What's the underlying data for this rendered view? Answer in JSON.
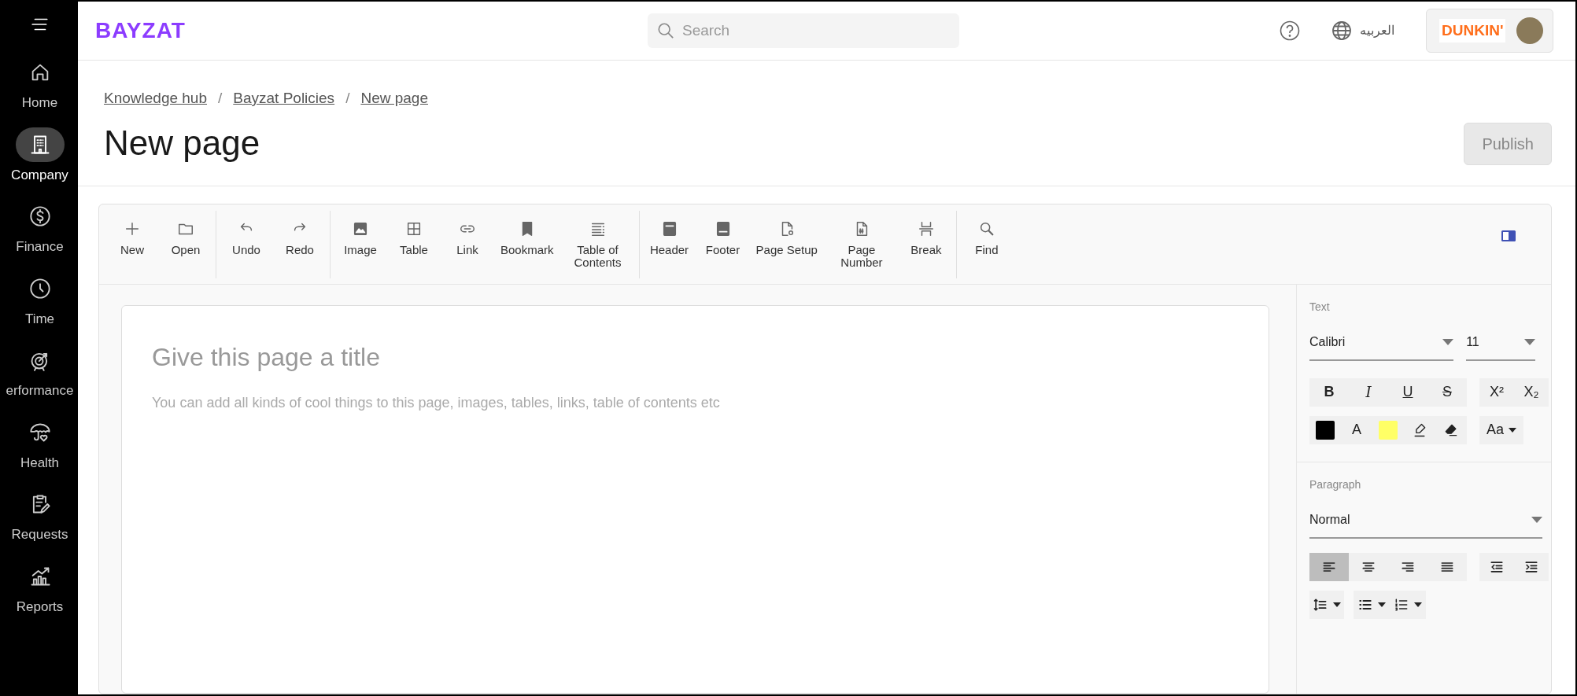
{
  "sidebar": {
    "items": [
      {
        "label": "Home",
        "selected": false
      },
      {
        "label": "Company",
        "selected": true
      },
      {
        "label": "Finance",
        "selected": false
      },
      {
        "label": "Time",
        "selected": false
      },
      {
        "label": "erformance",
        "selected": false
      },
      {
        "label": "Health",
        "selected": false
      },
      {
        "label": "Requests",
        "selected": false
      },
      {
        "label": "Reports",
        "selected": false
      }
    ]
  },
  "header": {
    "logo": "BAYZAT",
    "search": {
      "placeholder": "Search"
    },
    "language": "العربيه",
    "company_logo": "DUNKIN'"
  },
  "breadcrumb": {
    "items": [
      "Knowledge hub",
      "Bayzat Policies",
      "New page"
    ],
    "separators": [
      "/",
      "/"
    ]
  },
  "page_title": "New page",
  "publish_button": {
    "label": "Publish",
    "disabled": true
  },
  "toolbar": {
    "groups": [
      [
        {
          "label": "New"
        },
        {
          "label": "Open"
        }
      ],
      [
        {
          "label": "Undo"
        },
        {
          "label": "Redo"
        }
      ],
      [
        {
          "label": "Image"
        },
        {
          "label": "Table"
        },
        {
          "label": "Link"
        },
        {
          "label": "Bookmark"
        },
        {
          "label": "Table of Contents"
        }
      ],
      [
        {
          "label": "Header"
        },
        {
          "label": "Footer"
        },
        {
          "label": "Page Setup"
        },
        {
          "label": "Page Number"
        },
        {
          "label": "Break"
        }
      ],
      [
        {
          "label": "Find"
        }
      ]
    ]
  },
  "editor": {
    "title_placeholder": "Give this page a title",
    "body_placeholder": "You can add all kinds of cool things to this page, images, tables, links, table of contents etc"
  },
  "properties": {
    "text": {
      "heading": "Text",
      "font": "Calibri",
      "size": "11",
      "format": [
        {
          "kind": "bold",
          "label": "B"
        },
        {
          "kind": "italic",
          "label": "I"
        },
        {
          "kind": "underline",
          "label": "U"
        },
        {
          "kind": "strike",
          "label": "S"
        }
      ],
      "script": [
        {
          "label": "X²"
        },
        {
          "label": "X₂"
        }
      ],
      "colors": [
        {
          "kind": "swatch",
          "color": "#000000"
        },
        {
          "kind": "glyph",
          "label": "A"
        },
        {
          "kind": "swatch",
          "color": "#ffff66"
        },
        {
          "kind": "highlighter"
        },
        {
          "kind": "eraser"
        }
      ],
      "case": "Aa"
    },
    "paragraph": {
      "heading": "Paragraph",
      "style": "Normal",
      "align": [
        {
          "kind": "left",
          "selected": true
        },
        {
          "kind": "center",
          "selected": false
        },
        {
          "kind": "right",
          "selected": false
        },
        {
          "kind": "justify",
          "selected": false
        }
      ],
      "indent": [
        {
          "kind": "outdent"
        },
        {
          "kind": "indent"
        }
      ]
    }
  }
}
